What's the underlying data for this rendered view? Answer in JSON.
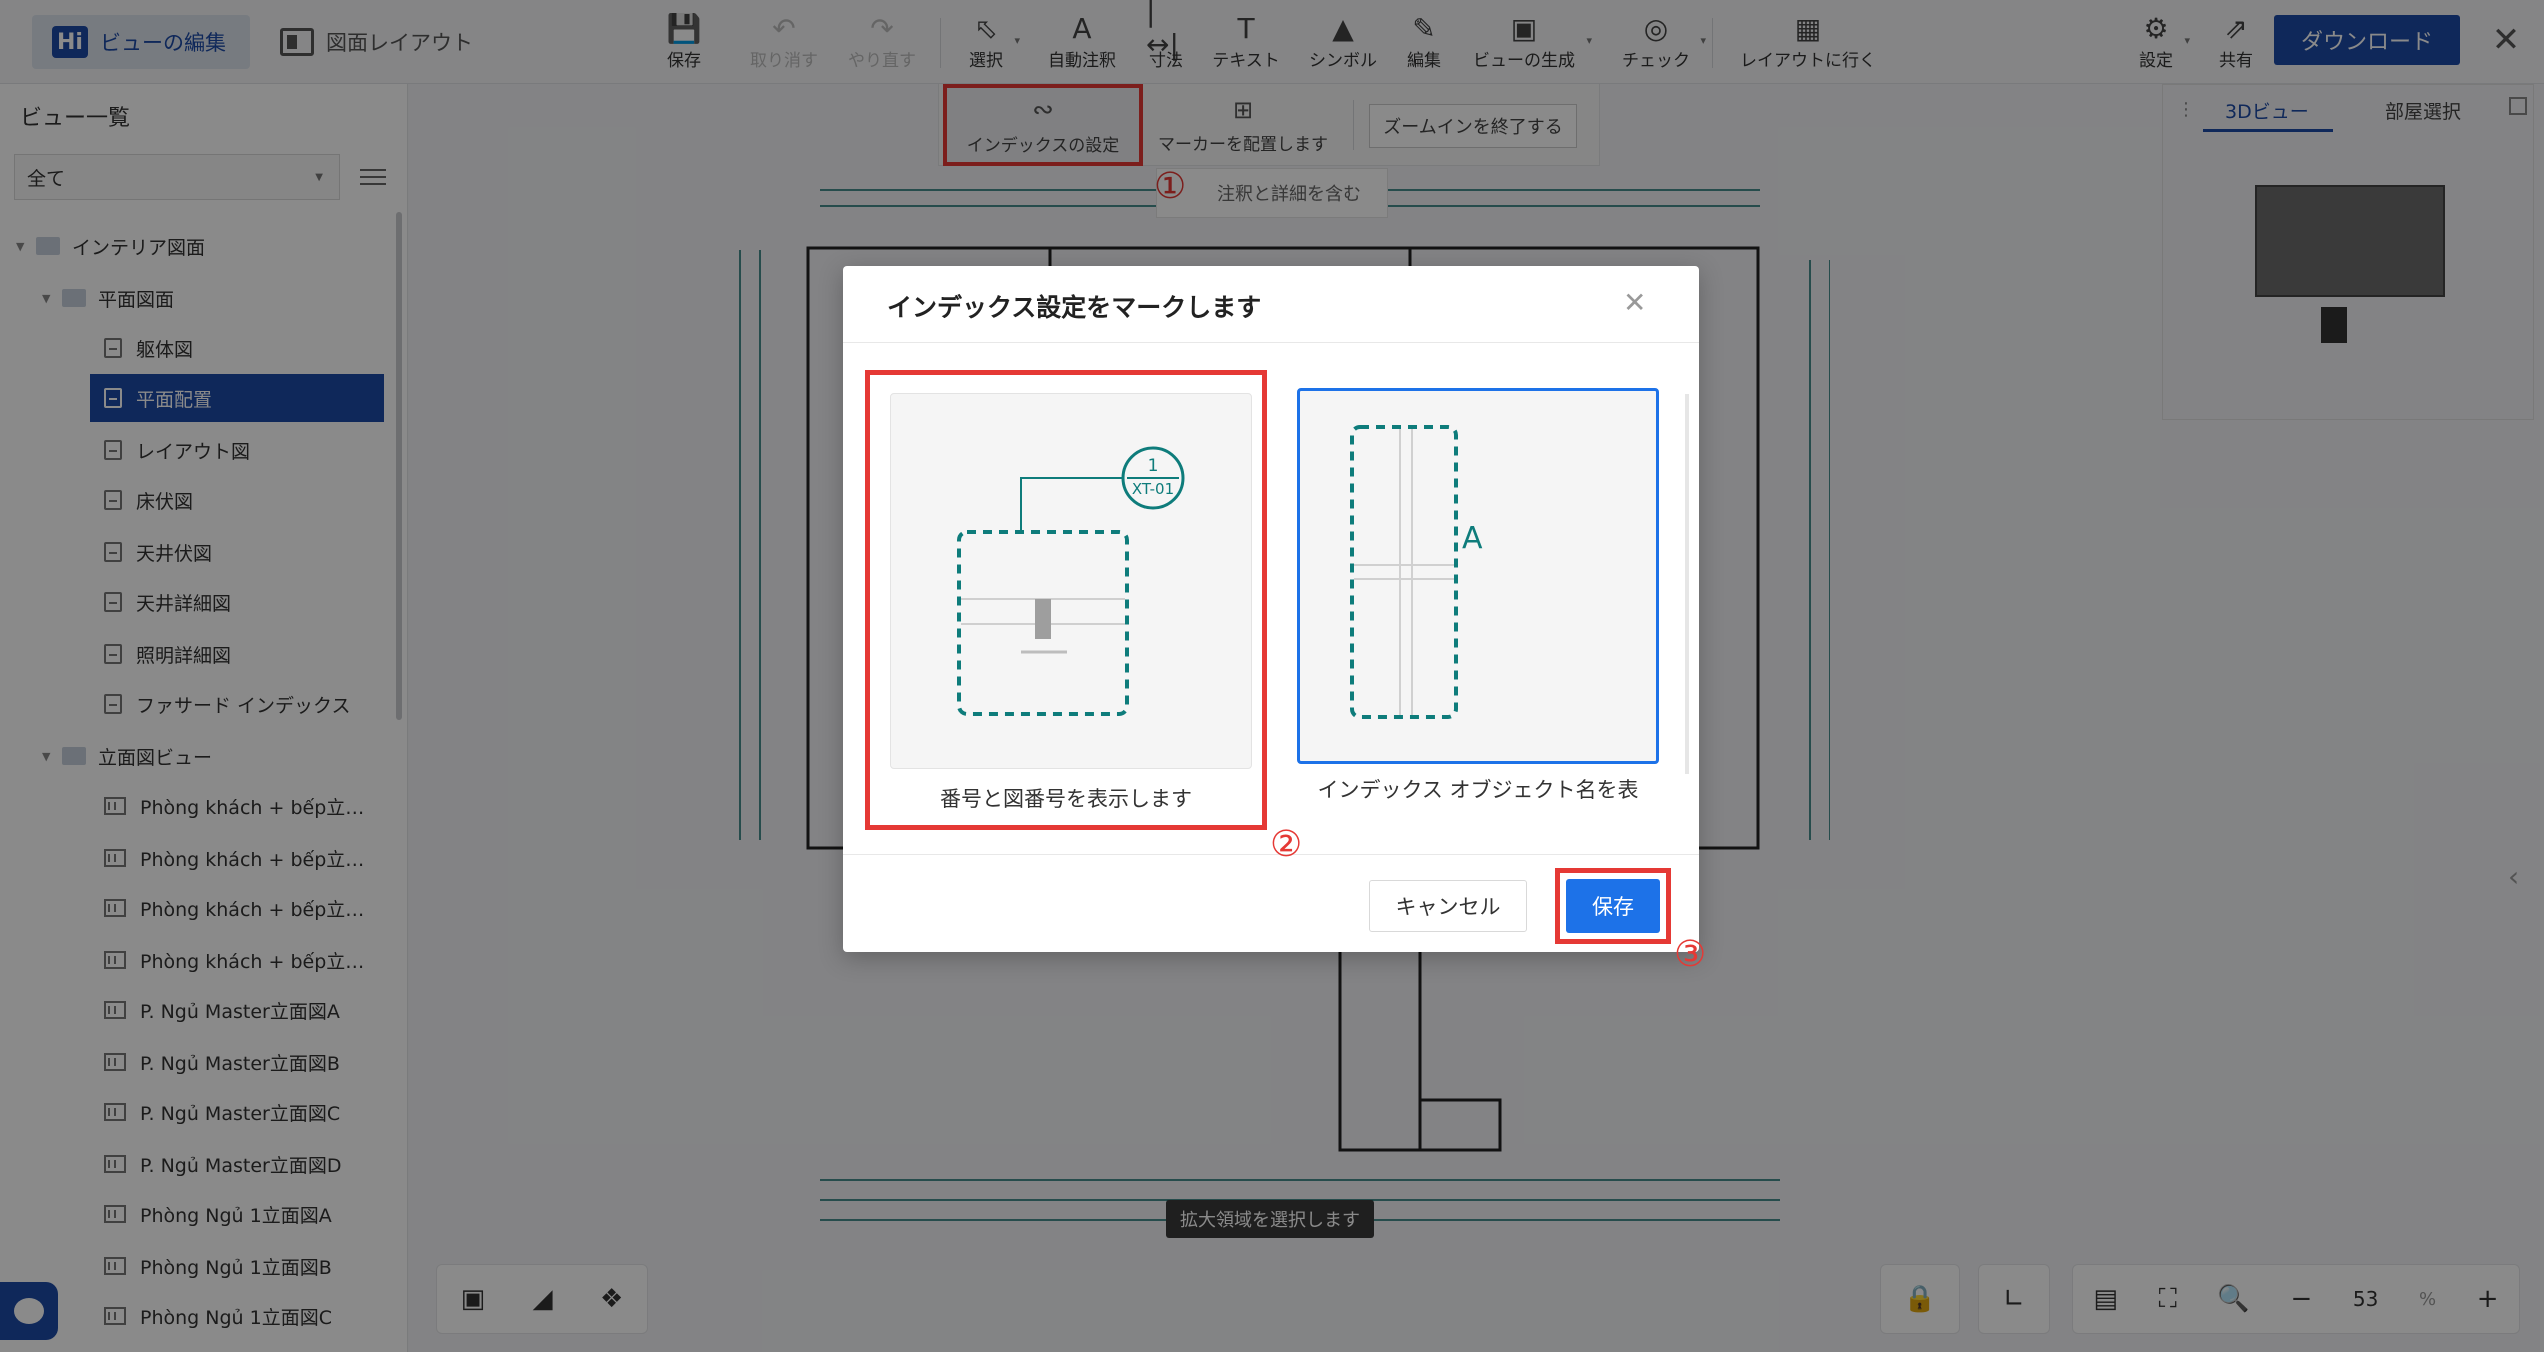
{
  "topbar": {
    "brand_logo": "Hi",
    "brand_label": "ビューの編集",
    "layout_tab": "図面レイアウト",
    "tools": [
      {
        "label": "保存",
        "icon": "save-icon"
      },
      {
        "label": "取り消す",
        "icon": "undo-icon"
      },
      {
        "label": "やり直す",
        "icon": "redo-icon"
      },
      {
        "label": "選択",
        "icon": "select-icon"
      },
      {
        "label": "自動注釈",
        "icon": "auto-annotate-icon"
      },
      {
        "label": "寸法",
        "icon": "dimension-icon"
      },
      {
        "label": "テキスト",
        "icon": "text-icon"
      },
      {
        "label": "シンボル",
        "icon": "symbol-icon"
      },
      {
        "label": "編集",
        "icon": "edit-icon"
      },
      {
        "label": "ビューの生成",
        "icon": "generate-view-icon"
      },
      {
        "label": "チェック",
        "icon": "check-icon"
      },
      {
        "label": "レイアウトに行く",
        "icon": "go-layout-icon"
      }
    ],
    "settings": "設定",
    "share": "共有",
    "download": "ダウンロード"
  },
  "subbar": {
    "index_settings": "インデックスの設定",
    "place_marker": "マーカーを配置します",
    "exit_zoom": "ズームインを終了する",
    "include_note": "注釈と詳細を含む"
  },
  "steps": {
    "one": "①",
    "two": "②",
    "three": "③"
  },
  "left": {
    "title": "ビュー一覧",
    "filter_value": "全て",
    "tree": [
      {
        "label": "インテリア図面"
      },
      {
        "label": "平面図面"
      },
      {
        "label": "躯体図"
      },
      {
        "label": "平面配置"
      },
      {
        "label": "レイアウト図"
      },
      {
        "label": "床伏図"
      },
      {
        "label": "天井伏図"
      },
      {
        "label": "天井詳細図"
      },
      {
        "label": "照明詳細図"
      },
      {
        "label": "ファサード インデックス"
      },
      {
        "label": "立面図ビュー"
      },
      {
        "label": "Phòng khách + bếp立…"
      },
      {
        "label": "Phòng khách + bếp立…"
      },
      {
        "label": "Phòng khách + bếp立…"
      },
      {
        "label": "Phòng khách + bếp立…"
      },
      {
        "label": "P. Ngủ Master立面図A"
      },
      {
        "label": "P. Ngủ Master立面図B"
      },
      {
        "label": "P. Ngủ Master立面図C"
      },
      {
        "label": "P. Ngủ Master立面図D"
      },
      {
        "label": "Phòng Ngủ 1立面図A"
      },
      {
        "label": "Phòng Ngủ 1立面図B"
      },
      {
        "label": "Phòng Ngủ 1立面図C"
      }
    ]
  },
  "view3d": {
    "tab_3d": "3Dビュー",
    "tab_room": "部屋選択"
  },
  "bottom": {
    "zoom": "53",
    "pct": "%",
    "tooltip": "拡大領域を選択します"
  },
  "dialog": {
    "title": "インデックス設定をマークします",
    "option1_label": "番号と図番号を表示します",
    "option1_num": "1",
    "option1_sheet": "XT-01",
    "option2_label": "インデックス オブジェクト名を表",
    "option2_letter": "A",
    "cancel": "キャンセル",
    "save": "保存"
  },
  "colors": {
    "brand": "#1d4aa6",
    "accent": "#1d72e8",
    "highlight": "#e53935",
    "teal": "#0e7c7b"
  }
}
